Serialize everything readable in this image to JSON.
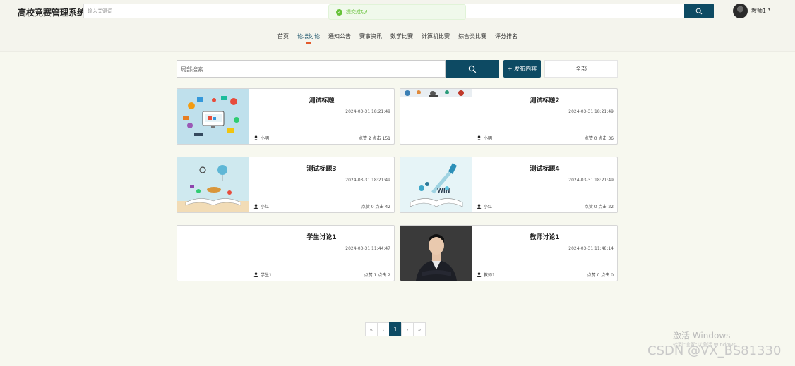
{
  "header": {
    "brand": "高校竞赛管理系统",
    "search_placeholder": "输入关键词",
    "toast": "提交成功!",
    "user_name": "教师1",
    "caret": "▾"
  },
  "nav": {
    "items": [
      "首页",
      "论坛讨论",
      "通知公告",
      "赛事资讯",
      "数学比赛",
      "计算机比赛",
      "综合类比赛",
      "评分排名"
    ],
    "active_index": 1
  },
  "toolbar": {
    "search_text": "局部搜索",
    "publish_label": "+ 发布内容",
    "all_label": "全部"
  },
  "cards": [
    {
      "title": "测试标题",
      "date": "2024-03-31 18:21:49",
      "author": "小明",
      "stats": "点赞 2   点击 151",
      "image": "infographic"
    },
    {
      "title": "测试标题2",
      "date": "2024-03-31 18:21:49",
      "author": "小明",
      "stats": "点赞 0   点击 36",
      "image": "people-strip"
    },
    {
      "title": "测试标题3",
      "date": "2024-03-31 18:21:49",
      "author": "小红",
      "stats": "点赞 0   点击 42",
      "image": "open-book-balloon"
    },
    {
      "title": "测试标题4",
      "date": "2024-03-31 18:21:49",
      "author": "小红",
      "stats": "点赞 0   点击 22",
      "image": "book-rocket-win"
    },
    {
      "title": "学生讨论1",
      "date": "2024-03-31 11:44:47",
      "author": "学生1",
      "stats": "点赞 1   点击 2",
      "image": ""
    },
    {
      "title": "教师讨论1",
      "date": "2024-03-31 11:48:14",
      "author": "教师1",
      "stats": "点赞 0   点击 0",
      "image": "portrait"
    }
  ],
  "pagination": {
    "first": "«",
    "prev": "‹",
    "current": "1",
    "next": "›",
    "last": "»"
  },
  "watermark": {
    "activate_title": "激活 Windows",
    "activate_sub": "转到\"设置\"以激活 Windows。",
    "csdn": "CSDN @VX_BS81330"
  },
  "colors": {
    "accent": "#0d4a63",
    "nav_underline": "#e35a2b",
    "success": "#67c23a",
    "page_bg": "#f7f8ef"
  }
}
